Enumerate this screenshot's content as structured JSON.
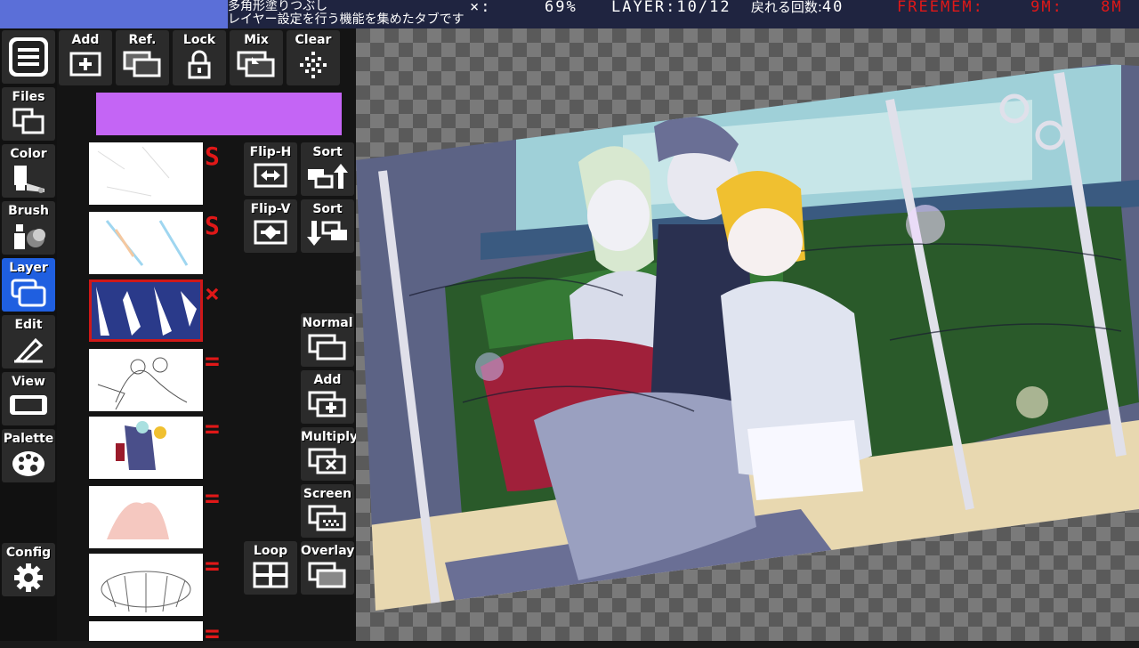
{
  "status": {
    "message_line1": "多角形塗りつぶし",
    "message_line2": "レイヤー設定を行う機能を集めたタブです",
    "zoom_label": "×:",
    "zoom_value": "69%",
    "layer_label": "LAYER:",
    "layer_value": "10/12",
    "undo_label": "戻れる回数:",
    "undo_value": "40",
    "freemem_label": "FREEMEM:",
    "freemem_value1": "9M:",
    "freemem_value2": "8M"
  },
  "sidebar": {
    "menu_icon": "hamburger-icon",
    "items": [
      {
        "label": "Files",
        "icon": "files-icon"
      },
      {
        "label": "Color",
        "icon": "color-icon"
      },
      {
        "label": "Brush",
        "icon": "brush-icon"
      },
      {
        "label": "Layer",
        "icon": "layer-icon"
      },
      {
        "label": "Edit",
        "icon": "edit-icon"
      },
      {
        "label": "View",
        "icon": "view-icon"
      },
      {
        "label": "Palette",
        "icon": "palette-icon"
      }
    ],
    "config_label": "Config"
  },
  "layer_toolbar": {
    "add": "Add",
    "ref": "Ref.",
    "lock": "Lock",
    "mix": "Mix",
    "clear": "Clear"
  },
  "layer_color": "#c465f5",
  "layers": [
    {
      "mark": "S"
    },
    {
      "mark": "S"
    },
    {
      "mark": "×",
      "selected": true
    },
    {
      "mark": "="
    },
    {
      "mark": "="
    },
    {
      "mark": "="
    },
    {
      "mark": "="
    },
    {
      "mark": "="
    }
  ],
  "layer_actions": {
    "flip_h": "Flip-H",
    "sort_up": "Sort",
    "flip_v": "Flip-V",
    "sort_down": "Sort",
    "normal": "Normal",
    "add": "Add",
    "multiply": "Multiply",
    "screen": "Screen",
    "loop": "Loop",
    "overlay": "Overlay"
  },
  "colors": {
    "accent": "#1f5fe0",
    "status_bar": "#1f2440",
    "status_blue": "#5b6fd8",
    "warn": "#e01818"
  }
}
